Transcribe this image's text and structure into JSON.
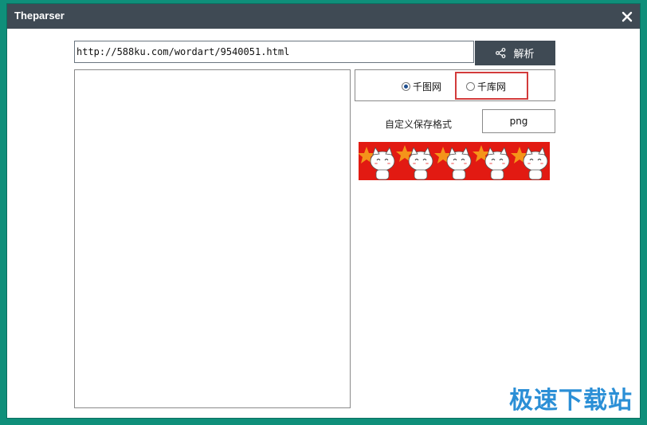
{
  "window": {
    "title": "Theparser"
  },
  "url_input": {
    "value": "http://588ku.com/wordart/9540051.html"
  },
  "parse_button": {
    "label": "解析",
    "icon": "share-icon"
  },
  "source_options": [
    {
      "label": "千图网",
      "selected": true
    },
    {
      "label": "千库网",
      "selected": false
    }
  ],
  "save_format": {
    "label": "自定义保存格式",
    "value": "png"
  },
  "preview": {
    "background_color": "#e21a12",
    "figure_count": 5
  },
  "watermark": {
    "text": "极速下载站",
    "color": "#2b8fd6"
  },
  "colors": {
    "titlebar": "#3f4a54",
    "highlight": "#d23b3b",
    "frame": "#0f8f7a"
  }
}
